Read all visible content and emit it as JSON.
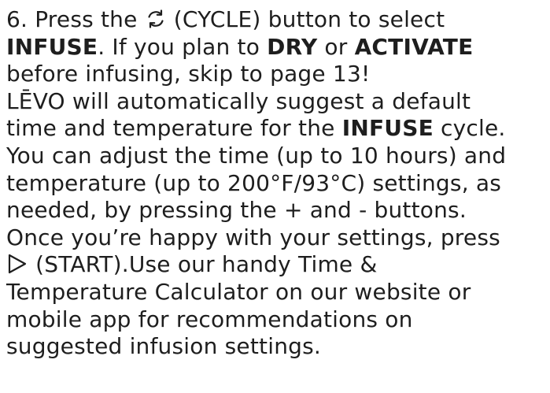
{
  "instructions": {
    "l1_a": "6. Press the ",
    "l1_b": " (CYCLE) button to select",
    "l2_bold_1": "INFUSE",
    "l2_a": ". If you plan to ",
    "l2_bold_2": "DRY",
    "l2_b": " or ",
    "l2_bold_3": "ACTIVATE",
    "l3": "before infusing, skip to page 13!",
    "l4": "LĒVO will automatically suggest a default",
    "l5_a": "time and temperature for the ",
    "l5_bold": "INFUSE",
    "l5_b": " cycle.",
    "l6": "You can adjust the time (up to 10 hours) and",
    "l7": "temperature (up to 200°F/93°C) settings, as",
    "l8": "needed, by pressing the + and - buttons.",
    "l9": "Once you’re happy with your settings, press",
    "l10_b": " (START).Use our handy Time &",
    "l11": "Temperature Calculator on our website or",
    "l12": "mobile app for recommendations on",
    "l13": "suggested infusion settings."
  },
  "icons": {
    "cycle": "cycle-icon",
    "start": "play-icon"
  }
}
